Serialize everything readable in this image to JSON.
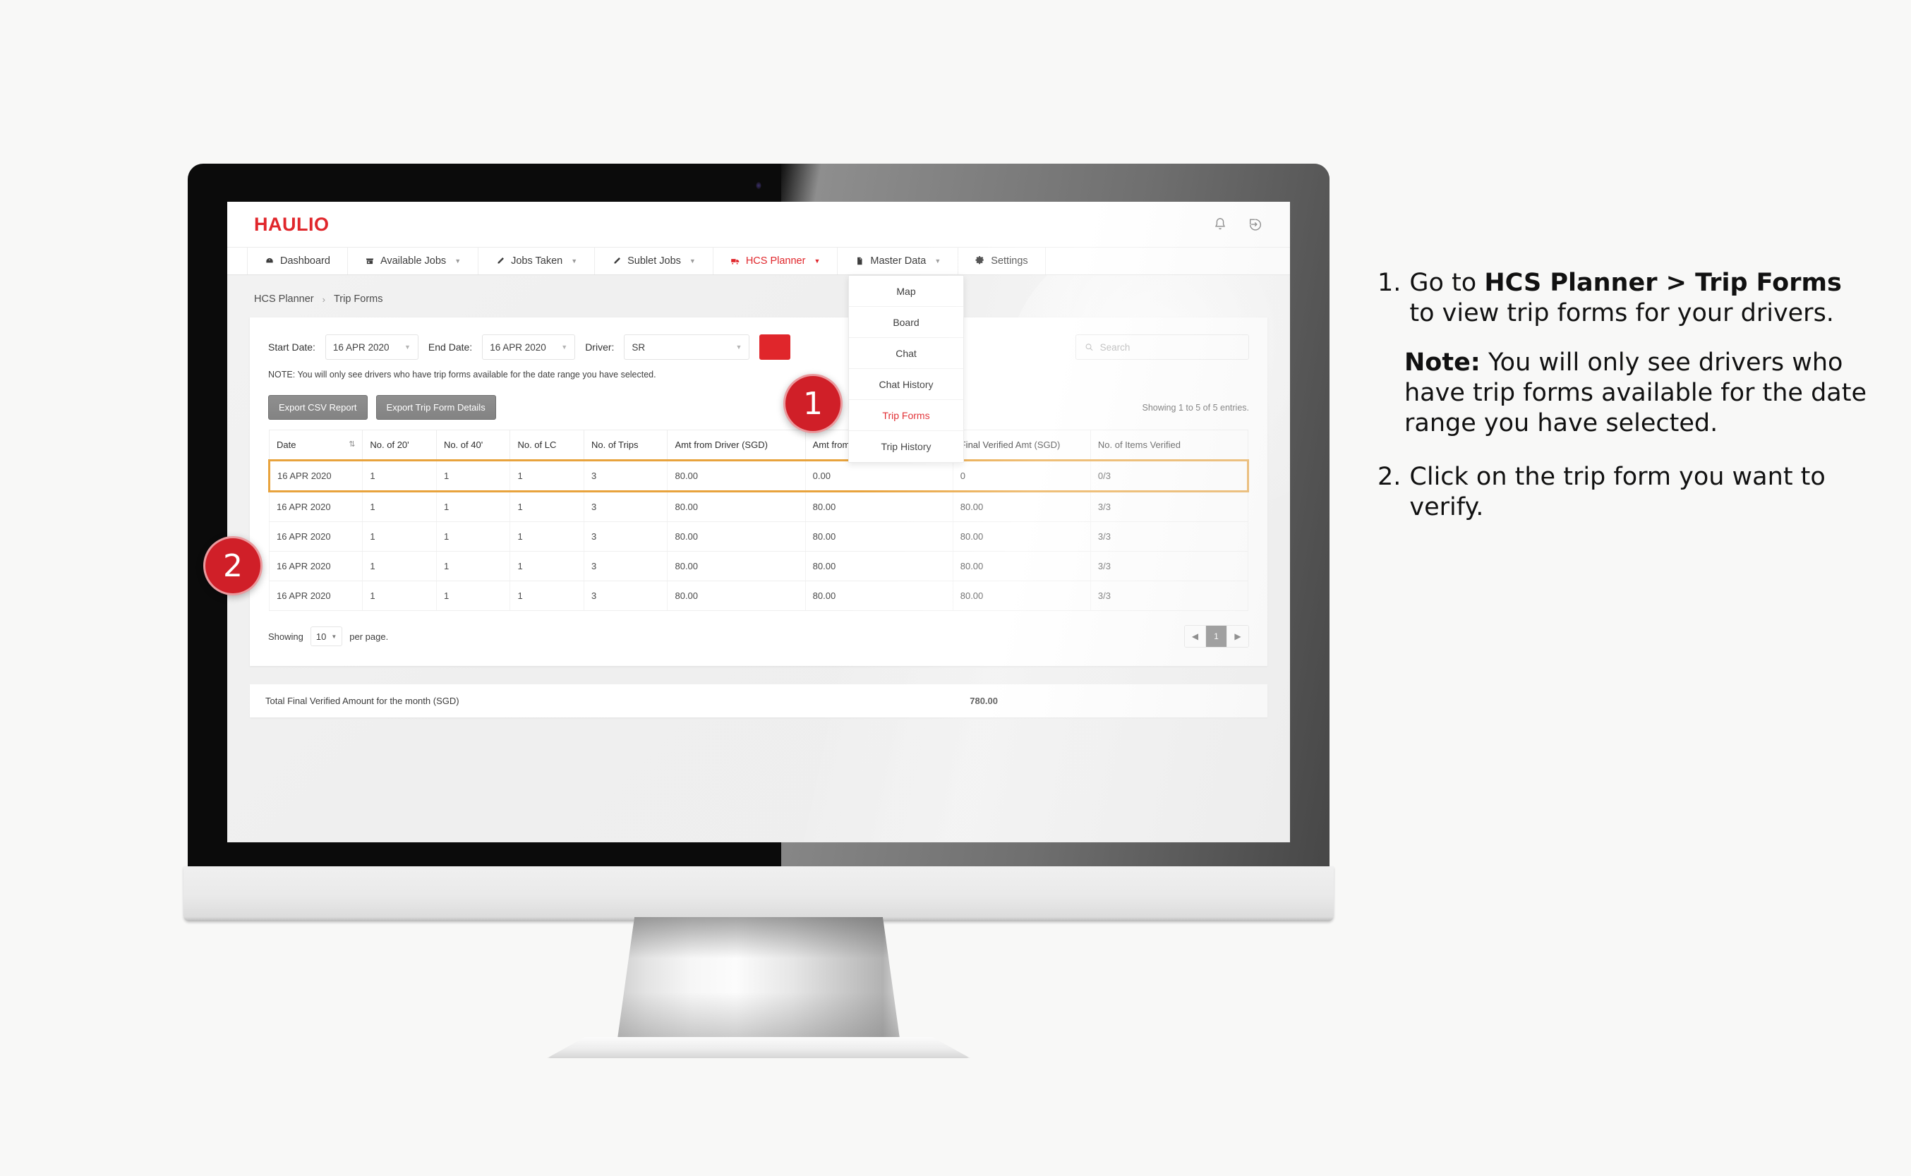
{
  "app": {
    "logo": "HAULIO",
    "header_icons": [
      {
        "name": "bell-icon",
        "label": "Notifications"
      },
      {
        "name": "logout-icon",
        "label": "Logout"
      }
    ],
    "nav": [
      {
        "label": "Dashboard",
        "icon": "dashboard-icon",
        "caret": false,
        "active": false
      },
      {
        "label": "Available Jobs",
        "icon": "store-icon",
        "caret": true,
        "active": false
      },
      {
        "label": "Jobs Taken",
        "icon": "pencil-icon",
        "caret": true,
        "active": false
      },
      {
        "label": "Sublet Jobs",
        "icon": "pencil-icon",
        "caret": true,
        "active": false
      },
      {
        "label": "HCS Planner",
        "icon": "truck-icon",
        "caret": true,
        "active": true
      },
      {
        "label": "Master Data",
        "icon": "document-icon",
        "caret": true,
        "active": false
      },
      {
        "label": "Settings",
        "icon": "gear-icon",
        "caret": false,
        "active": false
      }
    ],
    "dropdown": {
      "items": [
        {
          "label": "Map",
          "active": false
        },
        {
          "label": "Board",
          "active": false
        },
        {
          "label": "Chat",
          "active": false
        },
        {
          "label": "Chat History",
          "active": false
        },
        {
          "label": "Trip Forms",
          "active": true
        },
        {
          "label": "Trip History",
          "active": false
        }
      ]
    },
    "breadcrumb": {
      "parent": "HCS Planner",
      "separator": "›",
      "current": "Trip Forms"
    },
    "filters": {
      "start_date_label": "Start Date:",
      "start_date_value": "16 APR 2020",
      "end_date_label": "End Date:",
      "end_date_value": "16 APR 2020",
      "driver_label": "Driver:",
      "driver_value": "SR",
      "search_placeholder": "Search",
      "search_value": ""
    },
    "note": "NOTE: You will only see drivers who have trip forms available for the date range you have selected.",
    "buttons": {
      "export_csv": "Export CSV Report",
      "export_details": "Export Trip Form Details"
    },
    "showing_entries": "Showing 1 to 5 of 5 entries.",
    "table": {
      "columns": [
        "Date",
        "No. of 20'",
        "No. of 40'",
        "No. of LC",
        "No. of Trips",
        "Amt from Driver (SGD)",
        "Amt from Controller (SGD)",
        "Final Verified Amt (SGD)",
        "No. of Items Verified"
      ],
      "rows": [
        {
          "cells": [
            "16 APR 2020",
            "1",
            "1",
            "1",
            "3",
            "80.00",
            "0.00",
            "0",
            "0/3"
          ],
          "highlighted": true,
          "verified_alert": true
        },
        {
          "cells": [
            "16 APR 2020",
            "1",
            "1",
            "1",
            "3",
            "80.00",
            "80.00",
            "80.00",
            "3/3"
          ],
          "highlighted": false,
          "verified_alert": false
        },
        {
          "cells": [
            "16 APR 2020",
            "1",
            "1",
            "1",
            "3",
            "80.00",
            "80.00",
            "80.00",
            "3/3"
          ],
          "highlighted": false,
          "verified_alert": false
        },
        {
          "cells": [
            "16 APR 2020",
            "1",
            "1",
            "1",
            "3",
            "80.00",
            "80.00",
            "80.00",
            "3/3"
          ],
          "highlighted": false,
          "verified_alert": false
        },
        {
          "cells": [
            "16 APR 2020",
            "1",
            "1",
            "1",
            "3",
            "80.00",
            "80.00",
            "80.00",
            "3/3"
          ],
          "highlighted": false,
          "verified_alert": false
        }
      ]
    },
    "footer": {
      "showing_label": "Showing",
      "per_page_value": "10",
      "per_page_label": "per page.",
      "pager_prev": "◀",
      "pager_current": "1",
      "pager_next": "▶"
    },
    "total_bar": {
      "label": "Total Final Verified Amount for the month (SGD)",
      "amount": "780.00"
    }
  },
  "markers": {
    "one": "1",
    "two": "2"
  },
  "instructions": {
    "step1_num": "1.",
    "step1_prefix": "Go to ",
    "step1_bold": "HCS Planner > Trip Forms",
    "step1_suffix": " to view trip forms for your drivers.",
    "note_bold": "Note:",
    "note_text": " You will only see drivers who have trip forms available for the date range you have selected.",
    "step2_num": "2.",
    "step2_text": "Click on the trip form you want to verify."
  },
  "colors": {
    "brand_red": "#e0262b",
    "marker_red": "#d01f28",
    "highlight_orange": "#e8a33d",
    "button_grey": "#838383"
  }
}
